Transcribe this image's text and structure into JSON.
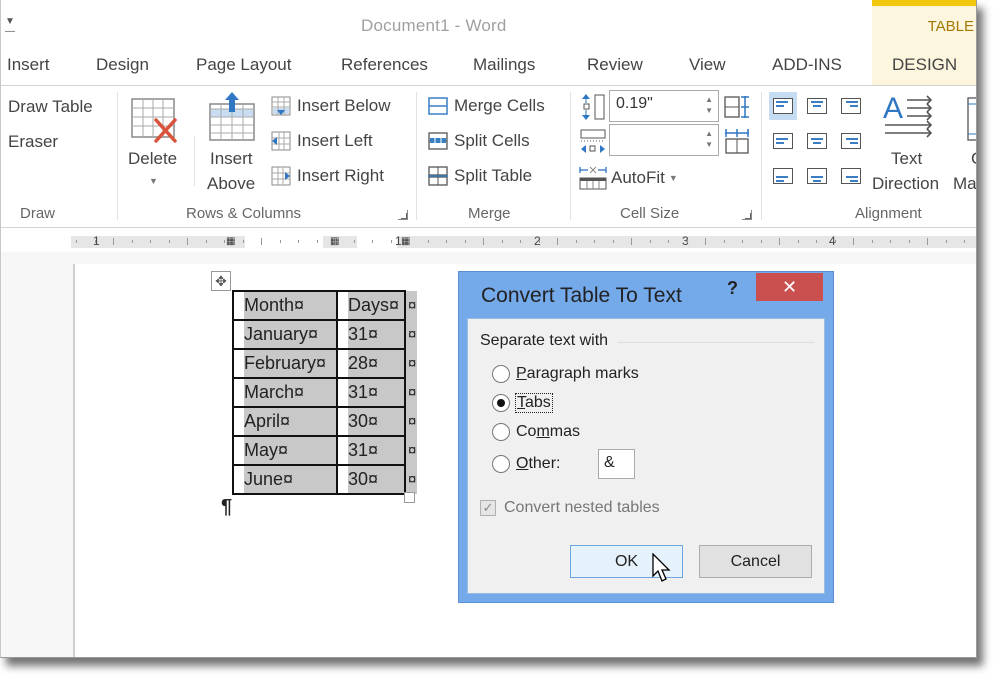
{
  "window": {
    "title": "Document1 - Word",
    "qat_customize_icon": "qat-customize-icon",
    "contextual_tab_group": "TABLE",
    "contextual_color": "#f2c70d"
  },
  "tabs": [
    {
      "label": "Insert"
    },
    {
      "label": "Design"
    },
    {
      "label": "Page Layout"
    },
    {
      "label": "References"
    },
    {
      "label": "Mailings"
    },
    {
      "label": "Review"
    },
    {
      "label": "View"
    },
    {
      "label": "ADD-INS"
    },
    {
      "label": "DESIGN"
    }
  ],
  "ribbon": {
    "draw": {
      "label": "Draw",
      "draw_table": "Draw Table",
      "eraser": "Eraser"
    },
    "rows_columns": {
      "label": "Rows & Columns",
      "delete": "Delete",
      "insert_above_1": "Insert",
      "insert_above_2": "Above",
      "insert_below": "Insert Below",
      "insert_left": "Insert Left",
      "insert_right": "Insert Right"
    },
    "merge": {
      "label": "Merge",
      "merge_cells": "Merge Cells",
      "split_cells": "Split Cells",
      "split_table": "Split Table"
    },
    "cell_size": {
      "label": "Cell Size",
      "height_value": "0.19\"",
      "width_value": "",
      "autofit": "AutoFit"
    },
    "alignment": {
      "label": "Alignment",
      "text_direction_1": "Text",
      "text_direction_2": "Direction",
      "cell_margins_partial_1": "C",
      "cell_margins_partial_2": "Ma",
      "selected_alignment": "top-left"
    }
  },
  "ruler": {
    "numbers": [
      "1",
      "1",
      "2",
      "3",
      "4"
    ]
  },
  "document": {
    "table_rows": [
      [
        "Month¤",
        "Days¤",
        "¤"
      ],
      [
        "January¤",
        "31¤",
        "¤"
      ],
      [
        "February¤",
        "28¤",
        "¤"
      ],
      [
        "March¤",
        "31¤",
        "¤"
      ],
      [
        "April¤",
        "30¤",
        "¤"
      ],
      [
        "May¤",
        "31¤",
        "¤"
      ],
      [
        "June¤",
        "30¤",
        "¤"
      ]
    ],
    "paragraph_mark": "¶"
  },
  "dialog": {
    "title": "Convert Table To Text",
    "help": "?",
    "close": "✕",
    "group_label": "Separate text with",
    "options": [
      {
        "pre": "",
        "key": "P",
        "post": "aragraph marks",
        "checked": false
      },
      {
        "pre": "",
        "key": "T",
        "post": "abs",
        "checked": true
      },
      {
        "pre": "Co",
        "key": "m",
        "post": "mas",
        "checked": false
      },
      {
        "pre": "",
        "key": "O",
        "post": "ther:",
        "checked": false
      }
    ],
    "other_value": "&",
    "convert_nested_label": "Convert nested tables",
    "convert_nested_checked": true,
    "convert_nested_enabled": false,
    "ok": "OK",
    "cancel": "Cancel",
    "accent": "#74a9ea",
    "close_color": "#c9504e"
  }
}
